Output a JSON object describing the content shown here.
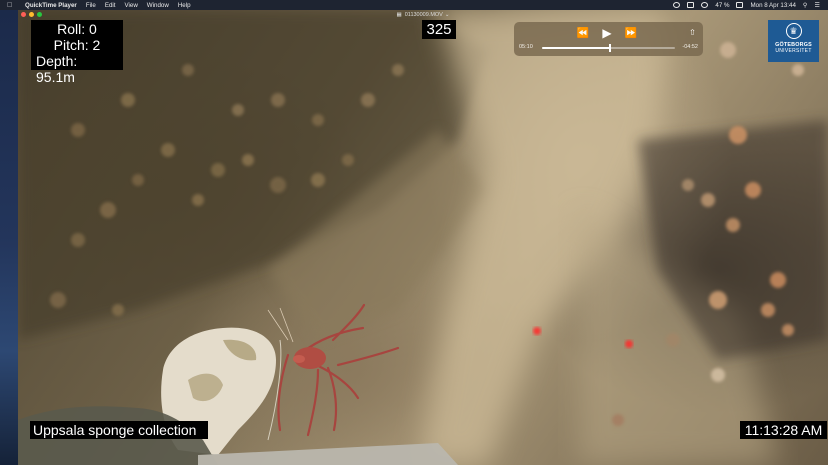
{
  "menubar": {
    "app_name": "QuickTime Player",
    "menus": [
      "File",
      "Edit",
      "View",
      "Window",
      "Help"
    ],
    "battery": "47 %",
    "datetime": "Mon 8 Apr  13:44"
  },
  "window": {
    "title": "01130009.MOV"
  },
  "overlay": {
    "roll": "Roll: 0",
    "pitch": "Pitch: 2",
    "depth": "Depth: 95.1m",
    "frame_counter": "325",
    "caption": "Uppsala sponge collection",
    "clock": "11:13:28 AM"
  },
  "logo": {
    "line1": "GÖTEBORGS",
    "line2": "UNIVERSITET"
  },
  "controls": {
    "elapsed": "05:10",
    "remaining": "-04:52",
    "progress_fraction": 0.51
  },
  "icons": {
    "apple": "apple-icon",
    "rewind": "rewind-icon",
    "play": "play-icon",
    "fast_forward": "fast-forward-icon",
    "share": "share-icon"
  },
  "colors": {
    "menubar": "#1e2431",
    "hud_bg": "#000000",
    "logo_bg": "#1e5a94",
    "laser": "#ff2a2a"
  }
}
